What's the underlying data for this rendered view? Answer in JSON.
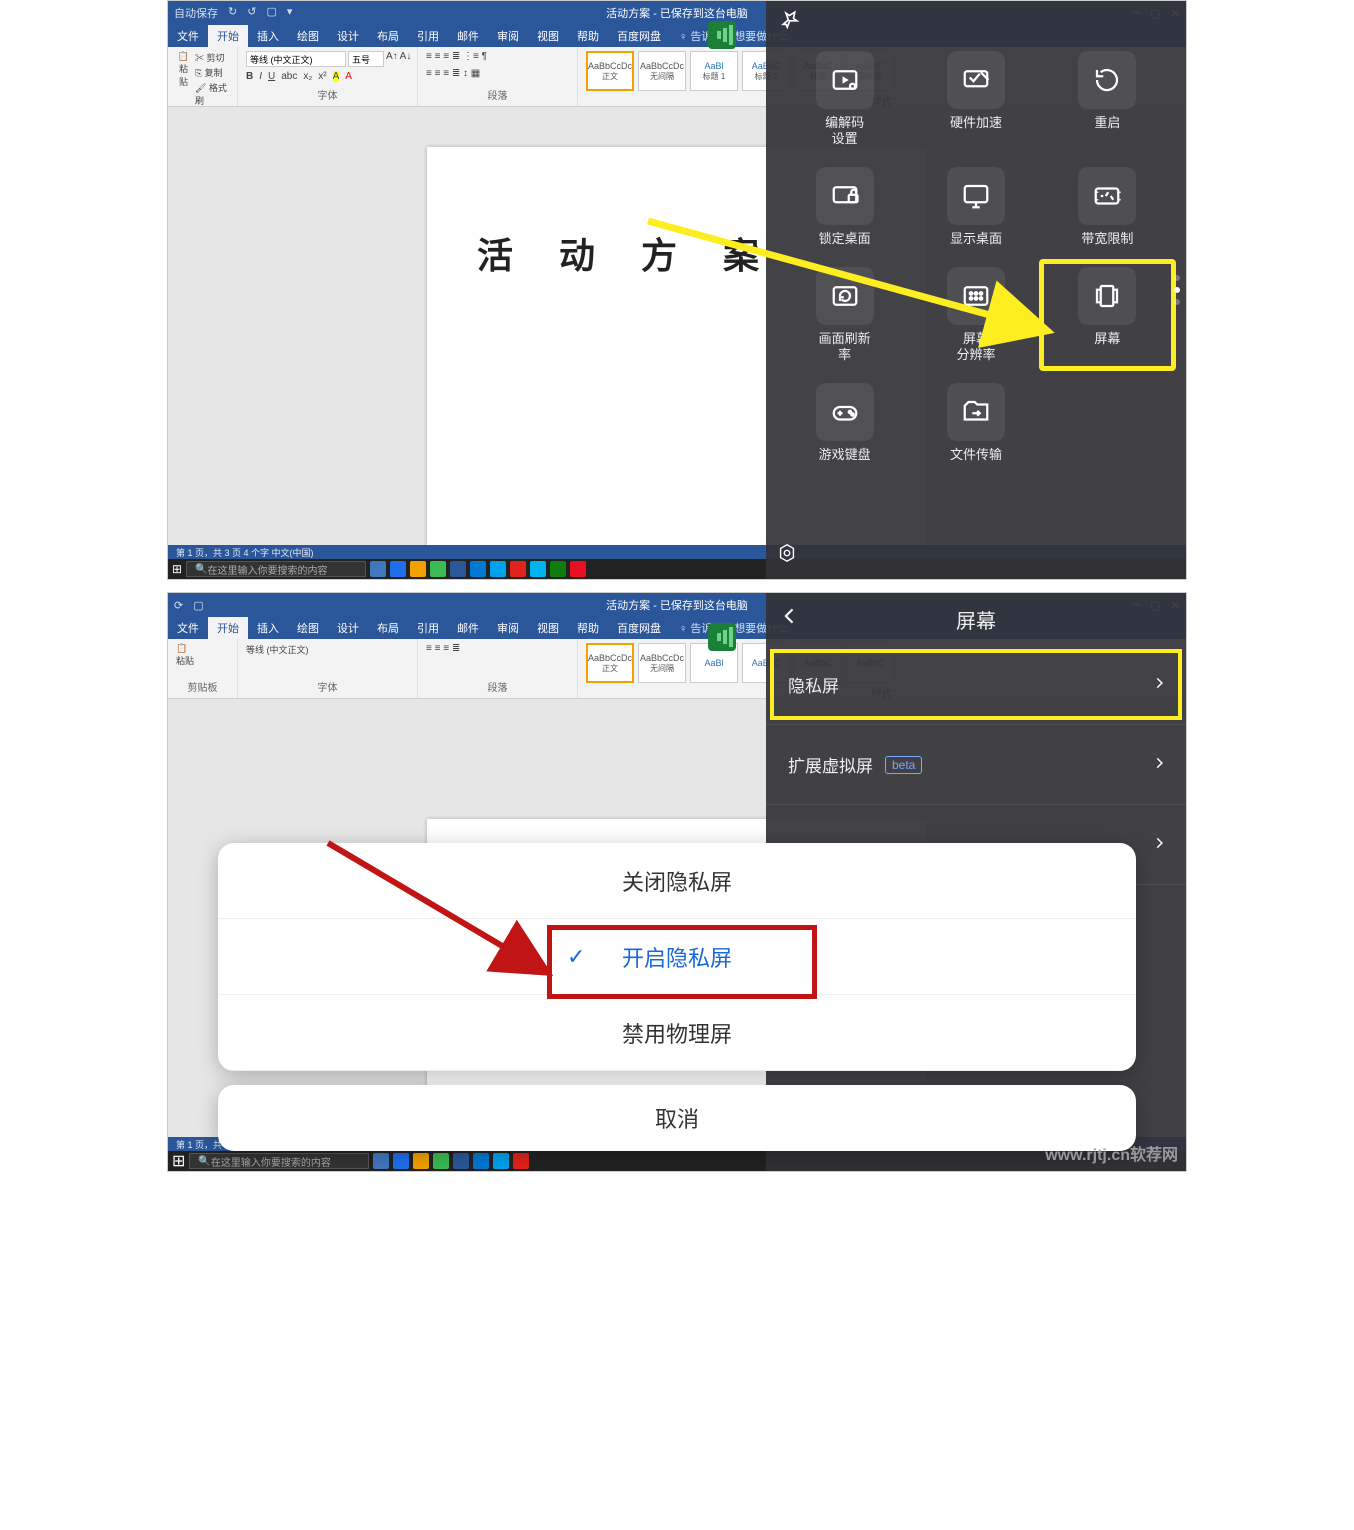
{
  "word": {
    "title": "活动方案 - 已保存到这台电脑",
    "qat": [
      "自动保存",
      "↻",
      "↺",
      "▢",
      "▾"
    ],
    "tabs": [
      "文件",
      "开始",
      "插入",
      "绘图",
      "设计",
      "布局",
      "引用",
      "邮件",
      "审阅",
      "视图",
      "帮助",
      "百度网盘"
    ],
    "tell_me": "告诉我你想要做什么",
    "ribbon": {
      "clipboard": {
        "paste": "粘贴",
        "cut": "剪切",
        "copy": "复制",
        "painter": "格式刷",
        "label": "剪贴板"
      },
      "font": {
        "name": "等线 (中文正文)",
        "size": "五号",
        "label": "字体"
      },
      "para_label": "段落",
      "styles": [
        {
          "s": "AaBbCcDc",
          "n": "正文"
        },
        {
          "s": "AaBbCcDc",
          "n": "无间隔"
        },
        {
          "s": "AaBl",
          "n": "标题 1"
        },
        {
          "s": "AaBbC",
          "n": "标题 2"
        },
        {
          "s": "AaBbC",
          "n": "标题"
        },
        {
          "s": "AaBbC",
          "n": "副标题"
        }
      ],
      "styles_label": "样式"
    },
    "doc_title": "活 动 方 案",
    "status": "第 1 页，共 3 页    4 个字    中文(中国)",
    "search_ph": "在这里输入你要搜索的内容"
  },
  "panel": {
    "tiles": [
      {
        "id": "codec",
        "label": "编解码\n设置"
      },
      {
        "id": "hwaccel",
        "label": "硬件加速"
      },
      {
        "id": "restart",
        "label": "重启"
      },
      {
        "id": "lock",
        "label": "锁定桌面"
      },
      {
        "id": "showdesk",
        "label": "显示桌面"
      },
      {
        "id": "bandwidth",
        "label": "带宽限制"
      },
      {
        "id": "refresh",
        "label": "画面刷新\n率"
      },
      {
        "id": "resolution",
        "label": "屏幕\n分辨率"
      },
      {
        "id": "screen",
        "label": "屏幕"
      },
      {
        "id": "gamekb",
        "label": "游戏键盘"
      },
      {
        "id": "filetx",
        "label": "文件传输"
      }
    ]
  },
  "screen_menu": {
    "title": "屏幕",
    "rows": [
      {
        "id": "privacy",
        "label": "隐私屏"
      },
      {
        "id": "extend",
        "label": "扩展虚拟屏",
        "badge": "beta"
      },
      {
        "id": "blank",
        "label": ""
      }
    ]
  },
  "sheet": {
    "off": "关闭隐私屏",
    "on": "开启隐私屏",
    "disable": "禁用物理屏",
    "cancel": "取消"
  },
  "watermark": "www.rjtj.cn软荐网"
}
